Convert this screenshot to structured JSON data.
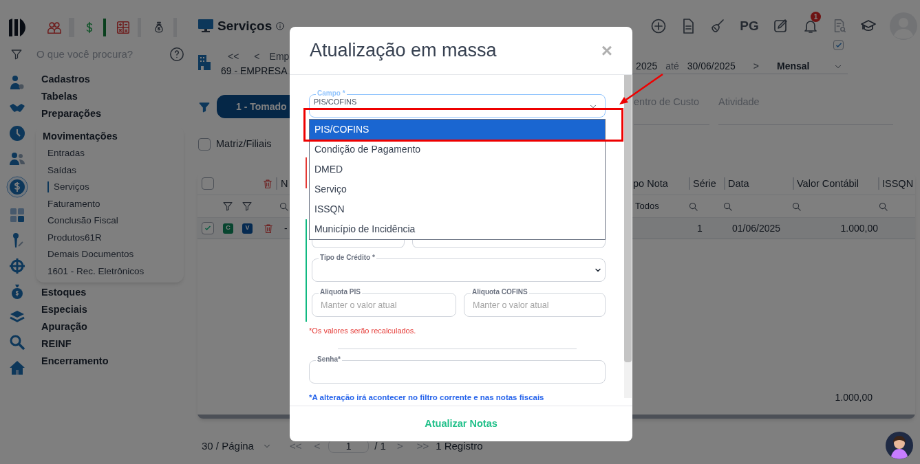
{
  "top_bar": {
    "pg_label": "PG",
    "notification_count": "1",
    "quick_check": {
      "checked": true
    }
  },
  "search": {
    "placeholder": "O que você procura?"
  },
  "menu": [
    {
      "label": "Cadastros",
      "expanded": false
    },
    {
      "label": "Tabelas",
      "expanded": false
    },
    {
      "label": "Preparações",
      "expanded": false
    },
    {
      "label": "Movimentações",
      "expanded": true,
      "children": [
        {
          "label": "Entradas",
          "selected": false
        },
        {
          "label": "Saídas",
          "selected": false
        },
        {
          "label": "Serviços",
          "selected": true
        },
        {
          "label": "Faturamento",
          "selected": false
        },
        {
          "label": "Conclusão Fiscal",
          "selected": false
        },
        {
          "label": "Produtos61R",
          "selected": false
        },
        {
          "label": "Demais Documentos",
          "selected": false
        },
        {
          "label": "1601 - Rec. Eletrônicos",
          "selected": false
        }
      ]
    },
    {
      "label": "Estoques",
      "expanded": false
    },
    {
      "label": "Especiais",
      "expanded": false
    },
    {
      "label": "Apuração",
      "expanded": false
    },
    {
      "label": "REINF",
      "expanded": false
    },
    {
      "label": "Encerramento",
      "expanded": false
    }
  ],
  "page": {
    "title": "Serviços",
    "first": "<<",
    "prev": "<",
    "company_label": "Emp",
    "company": "69 - EMPRESA",
    "period_start": "2025",
    "period_word": "até",
    "period_end": "30/06/2025",
    "next": ">",
    "period_type": "Mensal"
  },
  "tabs": [
    {
      "label": "1 - Tomado",
      "selected": true
    }
  ],
  "filters": [
    {
      "label": "entro de Custo"
    },
    {
      "label": "Atividade"
    }
  ],
  "matriz_filiais": {
    "label": "Matriz/Filiais",
    "checked": false
  },
  "table": {
    "select_all": {
      "checked": false
    },
    "columns": [
      {
        "label": "N"
      },
      {
        "label": "po Nota"
      },
      {
        "label": "Série"
      },
      {
        "label": "Data"
      },
      {
        "label": "Valor Contábil"
      },
      {
        "label": "ISSQN"
      }
    ],
    "type_filter": "Todos",
    "rows": [
      {
        "checked": true,
        "badges": [
          {
            "label": "C",
            "kind": "c"
          },
          {
            "label": "V",
            "kind": "v"
          }
        ],
        "cells": [
          "-",
          "",
          "1",
          "01/06/2025",
          "1.000,00"
        ]
      }
    ],
    "total": "1.000,00"
  },
  "pagination": {
    "page_size": "30 / Página",
    "first": "<<",
    "prev": "<",
    "page": "1",
    "pages": "/ 1",
    "next": ">",
    "last": ">>",
    "count": "1 Registro"
  },
  "modal": {
    "title": "Atualização em massa",
    "close": "×",
    "campo": {
      "label": "Campo *",
      "value": "PIS/COFINS",
      "expanded": true,
      "options": [
        {
          "label": "PIS/COFINS",
          "selected": true
        },
        {
          "label": "Condição de Pagamento",
          "selected": false
        },
        {
          "label": "DMED",
          "selected": false
        },
        {
          "label": "Serviço",
          "selected": false
        },
        {
          "label": "ISSQN",
          "selected": false
        },
        {
          "label": "Município de Incidência",
          "selected": false
        }
      ]
    },
    "sections": [
      {
        "color": "#e53935"
      },
      {
        "color": "#10b981"
      }
    ],
    "tipo_credito": {
      "label": "Tipo de Crédito *"
    },
    "aliquota_pis": {
      "label": "Aliquota PIS",
      "placeholder": "Manter o valor atual"
    },
    "aliquota_cofins": {
      "label": "Aliquota COFINS",
      "placeholder": "Manter o valor atual"
    },
    "note": "*Os valores serão recalculados.",
    "senha": {
      "label": "Senha*"
    },
    "footnote": "*A alteração irá acontecer no filtro corrente e nas notas fiscais",
    "submit": "Atualizar Notas"
  }
}
